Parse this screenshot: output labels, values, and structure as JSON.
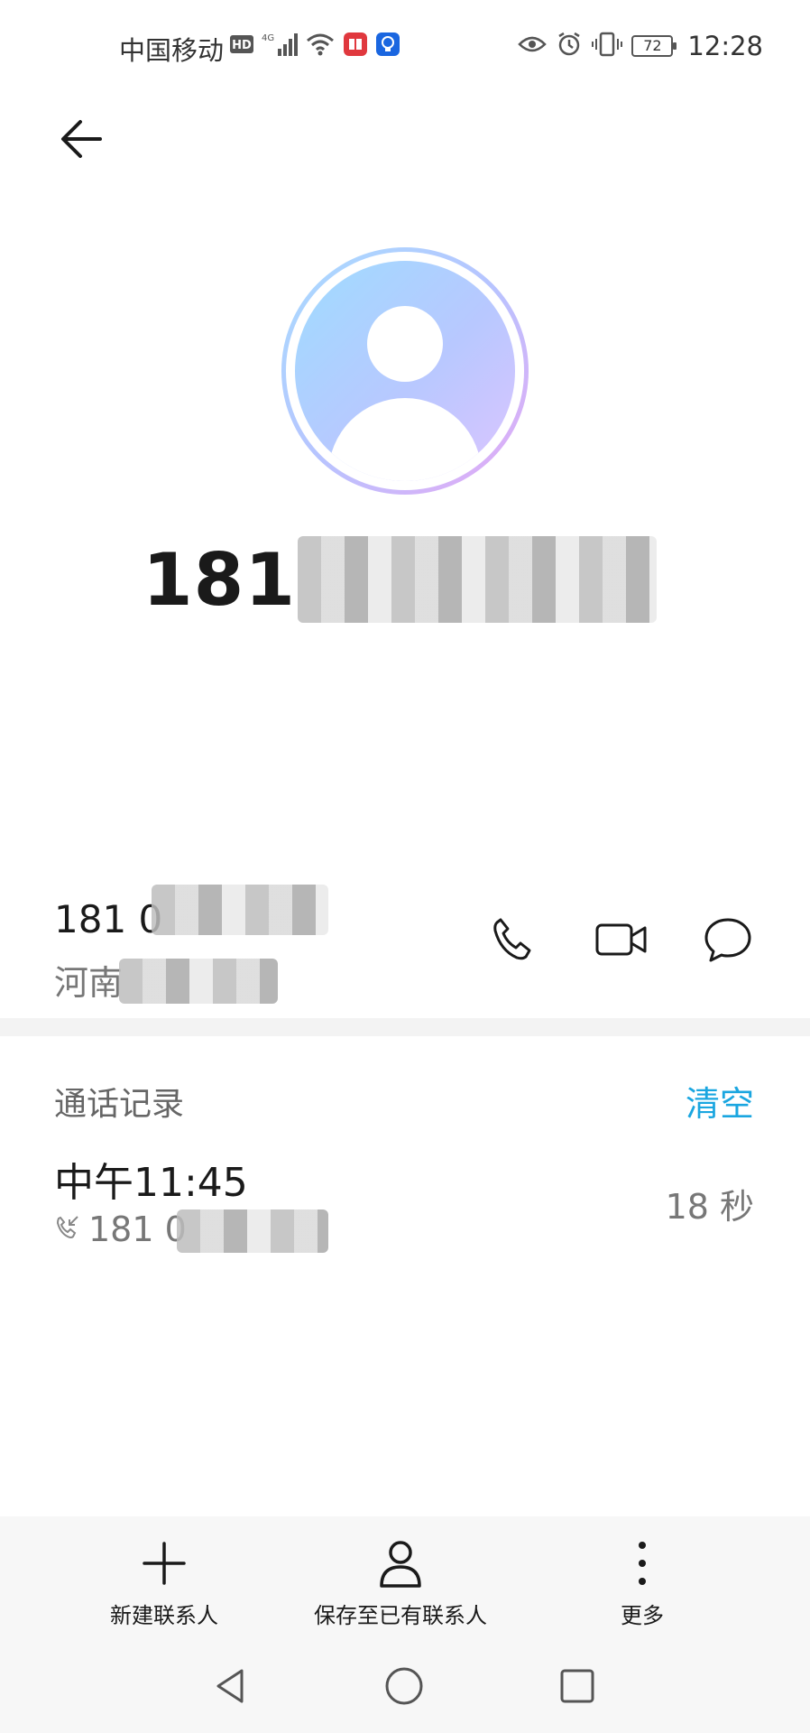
{
  "status_bar": {
    "carrier": "中国移动",
    "time": "12:28",
    "battery": "72",
    "icons_left": [
      "hd-icon",
      "signal-4g-icon",
      "wifi-icon",
      "book-app-icon",
      "bulb-app-icon"
    ],
    "icons_right": [
      "eye-icon",
      "alarm-icon",
      "vibrate-icon",
      "battery-icon"
    ]
  },
  "header": {
    "back_icon": "back-arrow-icon"
  },
  "contact": {
    "display_name_visible": "181",
    "number_visible": "181 0",
    "region_visible": "河南"
  },
  "actions": [
    "phone-icon",
    "video-call-icon",
    "message-icon"
  ],
  "call_log": {
    "title": "通话记录",
    "clear_label": "清空",
    "entries": [
      {
        "time": "中午11:45",
        "number_visible": "181 0",
        "duration": "18 秒",
        "icon": "incoming-call-icon"
      }
    ]
  },
  "toolbar": {
    "new_contact_label": "新建联系人",
    "save_existing_label": "保存至已有联系人",
    "more_label": "更多"
  },
  "colors": {
    "accent": "#1aa6e0",
    "avatar_gradient_start": "#9fdcff",
    "avatar_gradient_end": "#dcc4ff"
  }
}
